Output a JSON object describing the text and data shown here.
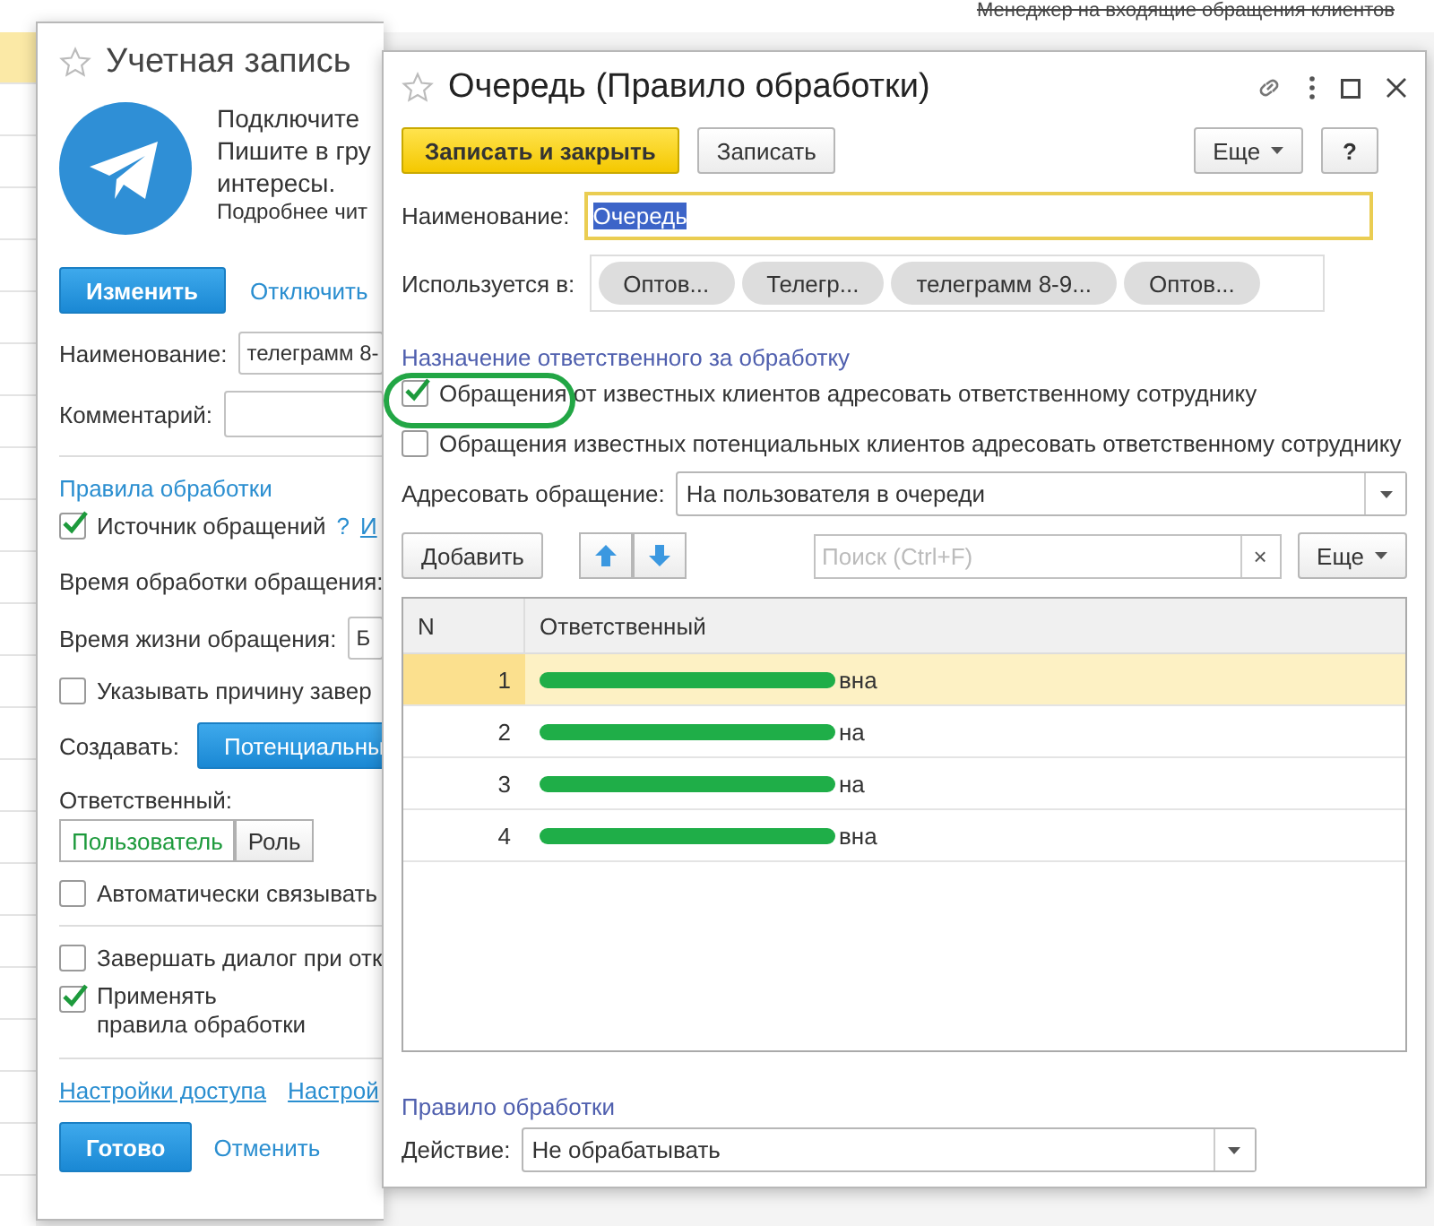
{
  "background": {
    "header": "Менеджер на входящие обращения клиентов"
  },
  "account_window": {
    "title": "Учетная запись",
    "intro_lines": [
      "Подключите",
      "Пишите в гру",
      "интересы."
    ],
    "more_text": "Подробнее чит",
    "edit_button": "Изменить",
    "disable_link": "Отключить",
    "name_label": "Наименование:",
    "name_value": "телеграмм 8-",
    "comment_label": "Комментарий:",
    "rules_heading": "Правила обработки",
    "source_check": {
      "label": "Источник обращений",
      "checked": true
    },
    "help_mark": "?",
    "source_link": "И",
    "processing_time_label": "Время обработки обращения:",
    "lifetime_label": "Время жизни обращения:",
    "lifetime_value": "Б",
    "reason_check": {
      "label": "Указывать причину завер",
      "checked": false
    },
    "create_label": "Создавать:",
    "create_button": "Потенциальны",
    "responsible_label": "Ответственный:",
    "responsible_options": [
      {
        "label": "Пользователь",
        "selected": true
      },
      {
        "label": "Роль",
        "selected": false
      }
    ],
    "auto_link_check": {
      "label": "Автоматически связывать",
      "checked": false
    },
    "finish_check": {
      "label": "Завершать диалог при отк",
      "checked": false
    },
    "apply_rules_check": {
      "label": "Применять правила обработки",
      "checked": true
    },
    "footer_links": [
      "Настройки доступа",
      "Настрой"
    ],
    "ok_button": "Готово",
    "cancel_link": "Отменить"
  },
  "queue_window": {
    "title": "Очередь (Правило обработки)",
    "save_close_button": "Записать и закрыть",
    "save_button": "Записать",
    "more_button": "Еще",
    "help_button": "?",
    "name_label": "Наименование:",
    "name_value": "Очередь",
    "used_in_label": "Используется в:",
    "used_in": [
      "Оптов...",
      "Телегр...",
      "телеграмм 8-9...",
      "Оптов..."
    ],
    "assignment_heading": "Назначение ответственного за обработку",
    "options": [
      {
        "label": "Обращения от известных клиентов адресовать ответственному сотруднику",
        "checked": true
      },
      {
        "label": "Обращения известных потенциальных клиентов адресовать ответственному сотруднику",
        "checked": false
      }
    ],
    "address_label": "Адресовать обращение:",
    "address_value": "На пользователя в очереди",
    "table_toolbar": {
      "add_button": "Добавить",
      "search_placeholder": "Поиск (Ctrl+F)",
      "clear_button": "×",
      "more_button": "Еще"
    },
    "table": {
      "columns": [
        "N",
        "Ответственный"
      ],
      "rows": [
        {
          "n": "1",
          "name_tail": "вна",
          "selected": true
        },
        {
          "n": "2",
          "name_tail": "на",
          "selected": false
        },
        {
          "n": "3",
          "name_tail": "на",
          "selected": false
        },
        {
          "n": "4",
          "name_tail": "вна",
          "selected": false
        }
      ]
    },
    "rule_heading": "Правило обработки",
    "action_label": "Действие:",
    "action_value": "Не обрабатывать"
  }
}
